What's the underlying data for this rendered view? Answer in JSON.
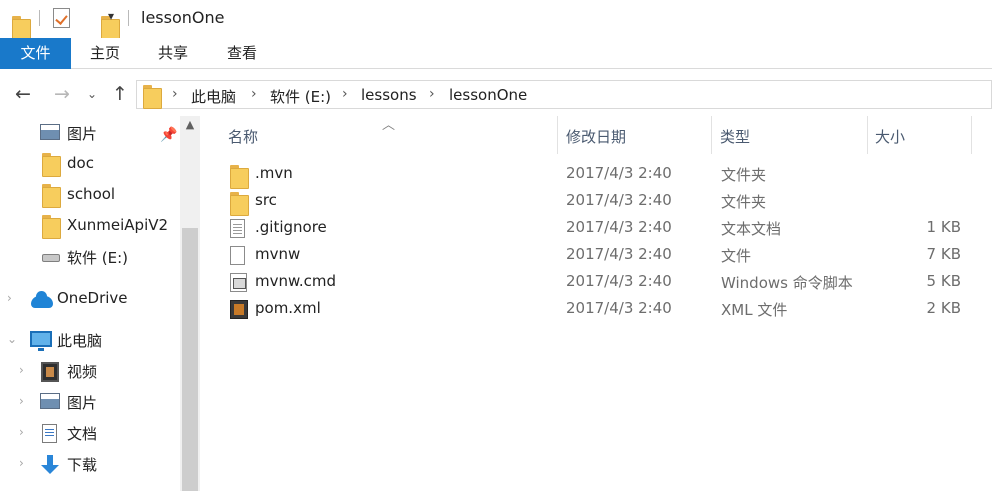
{
  "window": {
    "title": "lessonOne"
  },
  "ribbon": {
    "tabs": [
      {
        "label": "文件",
        "active": true
      },
      {
        "label": "主页"
      },
      {
        "label": "共享"
      },
      {
        "label": "查看"
      }
    ]
  },
  "address": {
    "breadcrumb": [
      "此电脑",
      "软件 (E:)",
      "lessons",
      "lessonOne"
    ]
  },
  "navpane": {
    "items": [
      {
        "label": "图片",
        "icon": "pictures-icon",
        "pinned": true
      },
      {
        "label": "doc",
        "icon": "folder-icon"
      },
      {
        "label": "school",
        "icon": "folder-icon"
      },
      {
        "label": "XunmeiApiV2",
        "icon": "folder-icon"
      },
      {
        "label": "软件 (E:)",
        "icon": "drive-icon"
      },
      {
        "label": "OneDrive",
        "icon": "onedrive-icon"
      },
      {
        "label": "此电脑",
        "icon": "pc-icon"
      },
      {
        "label": "视频",
        "icon": "video-icon"
      },
      {
        "label": "图片",
        "icon": "pictures-icon"
      },
      {
        "label": "文档",
        "icon": "documents-icon"
      },
      {
        "label": "下载",
        "icon": "download-icon"
      }
    ]
  },
  "columns": {
    "name": "名称",
    "modified": "修改日期",
    "type": "类型",
    "size": "大小"
  },
  "files": [
    {
      "name": ".mvn",
      "modified": "2017/4/3 2:40",
      "type": "文件夹",
      "size": "",
      "icon": "folder-icon"
    },
    {
      "name": "src",
      "modified": "2017/4/3 2:40",
      "type": "文件夹",
      "size": "",
      "icon": "folder-icon"
    },
    {
      "name": ".gitignore",
      "modified": "2017/4/3 2:40",
      "type": "文本文档",
      "size": "1 KB",
      "icon": "text-file-icon"
    },
    {
      "name": "mvnw",
      "modified": "2017/4/3 2:40",
      "type": "文件",
      "size": "7 KB",
      "icon": "file-icon"
    },
    {
      "name": "mvnw.cmd",
      "modified": "2017/4/3 2:40",
      "type": "Windows 命令脚本",
      "size": "5 KB",
      "icon": "cmd-file-icon"
    },
    {
      "name": "pom.xml",
      "modified": "2017/4/3 2:40",
      "type": "XML 文件",
      "size": "2 KB",
      "icon": "xml-file-icon"
    }
  ],
  "colors": {
    "accent": "#1979ca",
    "folder": "#f7cd5d"
  }
}
